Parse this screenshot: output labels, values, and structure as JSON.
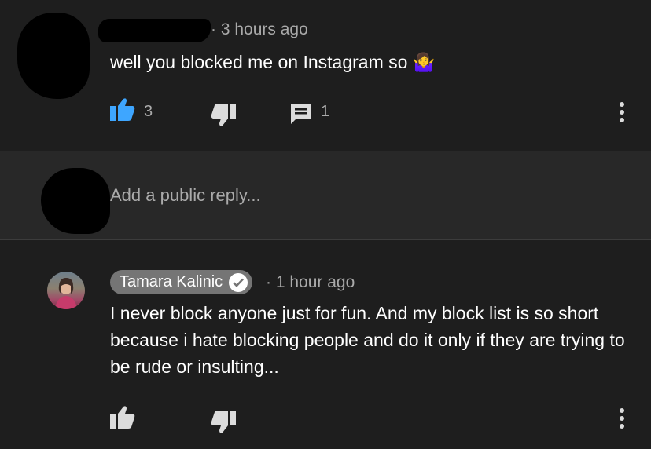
{
  "comment": {
    "time": "3 hours ago",
    "text": "well you blocked me on Instagram so 🤷‍♀️",
    "like_count": "3",
    "reply_count": "1"
  },
  "reply_box": {
    "placeholder": "Add a public reply..."
  },
  "reply": {
    "author": "Tamara Kalinic",
    "time": "1 hour ago",
    "text": "I never block anyone just for fun. And my block list is so short because i hate blocking people and do it only if they are trying to be rude or insulting..."
  },
  "icons": {
    "like": "thumbs-up-icon",
    "dislike": "thumbs-down-icon",
    "reply": "comment-icon",
    "more": "more-vertical-icon",
    "verified": "check-circle-icon"
  },
  "colors": {
    "background": "#1e1e1e",
    "reply_box_bg": "#282828",
    "like_active": "#3ea6ff",
    "name_chip": "#757575",
    "secondary_text": "#aaaaaa"
  }
}
